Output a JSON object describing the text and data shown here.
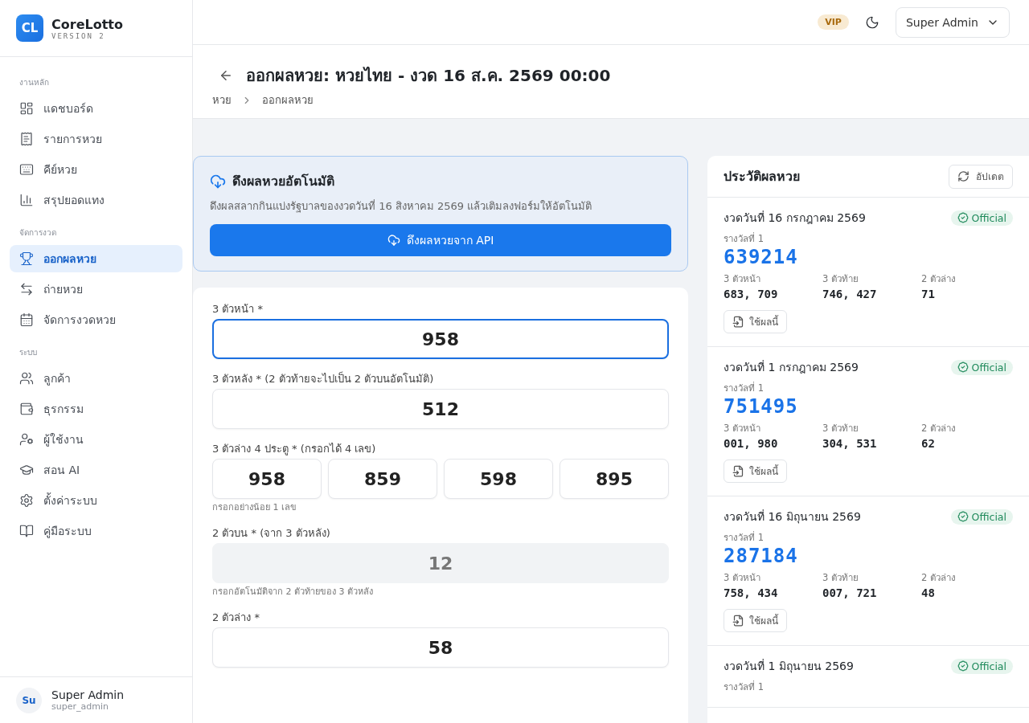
{
  "brand": {
    "logo": "CL",
    "name": "CoreLotto",
    "version": "VERSION 2"
  },
  "sidebar": {
    "sections": [
      {
        "label": "งานหลัก",
        "items": [
          {
            "label": "แดชบอร์ด",
            "selected": false
          },
          {
            "label": "รายการหวย",
            "selected": false
          },
          {
            "label": "คีย์หวย",
            "selected": false
          },
          {
            "label": "สรุปยอดแทง",
            "selected": false
          }
        ]
      },
      {
        "label": "จัดการงวด",
        "items": [
          {
            "label": "ออกผลหวย",
            "selected": true
          },
          {
            "label": "ถ่ายหวย",
            "selected": false
          },
          {
            "label": "จัดการงวดหวย",
            "selected": false
          }
        ]
      },
      {
        "label": "ระบบ",
        "items": [
          {
            "label": "ลูกค้า",
            "selected": false
          },
          {
            "label": "ธุรกรรม",
            "selected": false
          },
          {
            "label": "ผู้ใช้งาน",
            "selected": false
          },
          {
            "label": "สอน AI",
            "selected": false
          },
          {
            "label": "ตั้งค่าระบบ",
            "selected": false
          },
          {
            "label": "คู่มือระบบ",
            "selected": false
          }
        ]
      }
    ],
    "user": {
      "initials": "Su",
      "name": "Super Admin",
      "username": "super_admin"
    }
  },
  "topbar": {
    "badge": "VIP",
    "user": "Super Admin"
  },
  "header": {
    "title": "ออกผลหวย: หวยไทย - งวด 16 ส.ค. 2569 00:00",
    "breadcrumb": [
      "หวย",
      "ออกผลหวย"
    ]
  },
  "auto_fetch": {
    "title": "ดึงผลหวยอัตโนมัติ",
    "description": "ดึงผลสลากกินแบ่งรัฐบาลของงวดวันที่ 16 สิงหาคม 2569 แล้วเติมลงฟอร์มให้อัตโนมัติ",
    "button": "ดึงผลหวยจาก API"
  },
  "form": {
    "fields": [
      {
        "kind": "single",
        "label": "3 ตัวหน้า *",
        "values": [
          "958"
        ],
        "focused": true,
        "disabled": false
      },
      {
        "kind": "single",
        "label": "3 ตัวหลัง * (2 ตัวท้ายจะไปเป็น 2 ตัวบนอัตโนมัติ)",
        "values": [
          "512"
        ],
        "focused": false,
        "disabled": false
      },
      {
        "kind": "quad",
        "label": "3 ตัวล่าง 4 ประตู * (กรอกได้ 4 เลข)",
        "values": [
          "958",
          "859",
          "598",
          "895"
        ],
        "focused": false,
        "disabled": false,
        "hint": "กรอกอย่างน้อย 1 เลข"
      },
      {
        "kind": "single",
        "label": "2 ตัวบน * (จาก 3 ตัวหลัง)",
        "values": [
          "12"
        ],
        "focused": false,
        "disabled": true,
        "hint": "กรอกอัตโนมัติจาก 2 ตัวท้ายของ 3 ตัวหลัง"
      },
      {
        "kind": "single",
        "label": "2 ตัวล่าง *",
        "values": [
          "58"
        ],
        "focused": false,
        "disabled": false
      }
    ]
  },
  "history": {
    "title": "ประวัติผลหวย",
    "refresh": "อัปเดต",
    "items": [
      {
        "date": "งวดวันที่ 16 กรกฎาคม 2569",
        "status": "Official",
        "prize_label": "รางวัลที่ 1",
        "prize": "639214",
        "groups": [
          {
            "label": "3 ตัวหน้า",
            "value": "683, 709"
          },
          {
            "label": "3 ตัวท้าย",
            "value": "746, 427"
          },
          {
            "label": "2 ตัวล่าง",
            "value": "71"
          }
        ],
        "use": "ใช้ผลนี้"
      },
      {
        "date": "งวดวันที่ 1 กรกฎาคม 2569",
        "status": "Official",
        "prize_label": "รางวัลที่ 1",
        "prize": "751495",
        "groups": [
          {
            "label": "3 ตัวหน้า",
            "value": "001, 980"
          },
          {
            "label": "3 ตัวท้าย",
            "value": "304, 531"
          },
          {
            "label": "2 ตัวล่าง",
            "value": "62"
          }
        ],
        "use": "ใช้ผลนี้"
      },
      {
        "date": "งวดวันที่ 16 มิถุนายน 2569",
        "status": "Official",
        "prize_label": "รางวัลที่ 1",
        "prize": "287184",
        "groups": [
          {
            "label": "3 ตัวหน้า",
            "value": "758, 434"
          },
          {
            "label": "3 ตัวท้าย",
            "value": "007, 721"
          },
          {
            "label": "2 ตัวล่าง",
            "value": "48"
          }
        ],
        "use": "ใช้ผลนี้"
      },
      {
        "date": "งวดวันที่ 1 มิถุนายน 2569",
        "status": "Official",
        "prize_label": "รางวัลที่ 1"
      }
    ]
  }
}
